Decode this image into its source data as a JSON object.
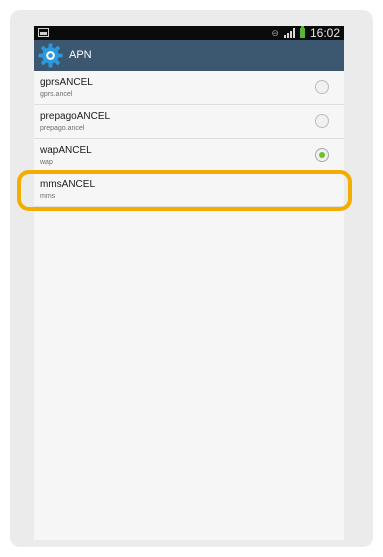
{
  "status_bar": {
    "time": "16:02",
    "icons": [
      "picture-icon",
      "sync-icon",
      "signal-icon",
      "battery-icon"
    ]
  },
  "action_bar": {
    "title": "APN",
    "icon": "settings-gear-icon",
    "background": "#3b5870"
  },
  "apn_list": [
    {
      "name": "gprsANCEL",
      "apn": "gprs.ancel",
      "selected": false
    },
    {
      "name": "prepagoANCEL",
      "apn": "prepago.ancel",
      "selected": false
    },
    {
      "name": "wapANCEL",
      "apn": "wap",
      "selected": true
    },
    {
      "name": "mmsANCEL",
      "apn": "mms",
      "selected": false,
      "has_radio": false
    }
  ],
  "colors": {
    "accent_selected": "#6cc028",
    "highlight": "#f2ad00"
  }
}
